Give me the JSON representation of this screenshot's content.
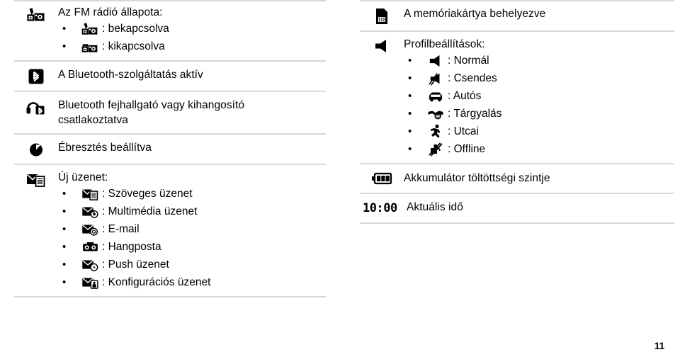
{
  "document": {
    "page_number": "11",
    "language": "hu"
  },
  "left_column": {
    "rows": [
      {
        "icon": "fm-radio-icon",
        "title": "Az FM rádió állapota:",
        "bullets": [
          {
            "icon": "fm-radio-on-icon",
            "label": ": bekapcsolva"
          },
          {
            "icon": "fm-radio-off-icon",
            "label": ": kikapcsolva"
          }
        ]
      },
      {
        "icon": "bluetooth-active-icon",
        "title": "A Bluetooth-szolgáltatás aktív",
        "bullets": []
      },
      {
        "icon": "bluetooth-headset-icon",
        "title": "Bluetooth fejhallgató vagy kihangosító\ncsatlakoztatva",
        "bullets": []
      },
      {
        "icon": "alarm-clock-icon",
        "title": "Ébresztés beállítva",
        "bullets": []
      },
      {
        "icon": "new-message-icon",
        "title": "Új üzenet:",
        "bullets": [
          {
            "icon": "text-message-icon",
            "label": ": Szöveges üzenet"
          },
          {
            "icon": "multimedia-message-icon",
            "label": ": Multimédia üzenet"
          },
          {
            "icon": "email-message-icon",
            "label": ": E-mail"
          },
          {
            "icon": "voicemail-icon",
            "label": ": Hangposta"
          },
          {
            "icon": "push-message-icon",
            "label": ": Push üzenet"
          },
          {
            "icon": "configuration-message-icon",
            "label": ": Konfigurációs üzenet"
          }
        ]
      }
    ]
  },
  "right_column": {
    "rows": [
      {
        "icon": "memory-card-icon",
        "title": "A memóriakártya behelyezve",
        "bullets": []
      },
      {
        "icon": "speaker-icon",
        "title": "Profilbeállítások:",
        "bullets": [
          {
            "icon": "speaker-icon",
            "label": ": Normál"
          },
          {
            "icon": "speaker-mute-icon",
            "label": ": Csendes"
          },
          {
            "icon": "car-icon",
            "label": ": Autós"
          },
          {
            "icon": "handshake-icon",
            "label": ": Tárgyalás"
          },
          {
            "icon": "running-person-icon",
            "label": ": Utcai"
          },
          {
            "icon": "offline-icon",
            "label": ": Offline"
          }
        ]
      },
      {
        "icon": "battery-icon",
        "title": "Akkumulátor töltöttségi szintje",
        "bullets": []
      },
      {
        "icon": "clock-time-glyph",
        "icon_text": "10:00",
        "title": "Aktuális idő",
        "bullets": []
      }
    ]
  },
  "bullet_char": "•",
  "colors": {
    "text": "#000000",
    "rule": "#d8d8d8",
    "background": "#ffffff"
  }
}
